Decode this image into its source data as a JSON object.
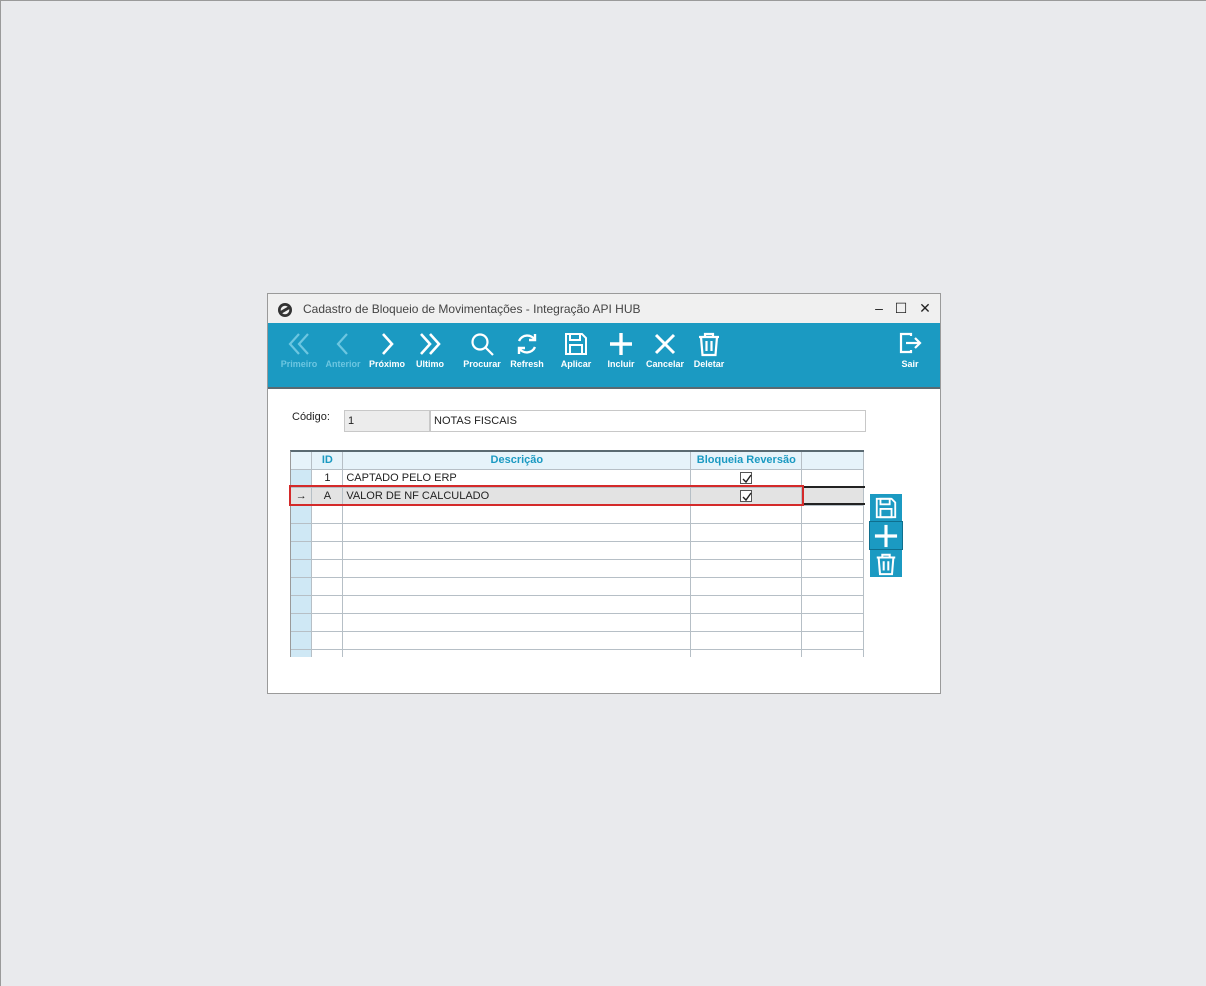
{
  "window": {
    "title": "Cadastro de Bloqueio de Movimentações - Integração API HUB",
    "controls": {
      "minimize": "–",
      "maximize": "☐",
      "close": "✕"
    }
  },
  "toolbar": {
    "buttons": [
      {
        "label": "Primeiro",
        "icon": "double-chevron-left-icon",
        "enabled": false
      },
      {
        "label": "Anterior",
        "icon": "chevron-left-icon",
        "enabled": false
      },
      {
        "label": "Próximo",
        "icon": "chevron-right-icon",
        "enabled": true
      },
      {
        "label": "Ultimo",
        "icon": "double-chevron-right-icon",
        "enabled": true
      },
      {
        "label": "Procurar",
        "icon": "search-icon",
        "enabled": true
      },
      {
        "label": "Refresh",
        "icon": "refresh-icon",
        "enabled": true
      },
      {
        "label": "Aplicar",
        "icon": "save-icon",
        "enabled": true
      },
      {
        "label": "Incluir",
        "icon": "plus-icon",
        "enabled": true
      },
      {
        "label": "Cancelar",
        "icon": "close-icon",
        "enabled": true
      },
      {
        "label": "Deletar",
        "icon": "trash-icon",
        "enabled": true
      },
      {
        "label": "Sair",
        "icon": "exit-icon",
        "enabled": true
      }
    ]
  },
  "form": {
    "codigo_label": "Código:",
    "codigo_value": "1",
    "descricao_value": "NOTAS FISCAIS"
  },
  "grid": {
    "columns": [
      "ID",
      "Descrição",
      "Bloqueia Reversão"
    ],
    "rows": [
      {
        "indicator": "",
        "id": "1",
        "descricao": "CAPTADO PELO ERP",
        "bloqueia": true
      },
      {
        "indicator": "→",
        "id": "A",
        "descricao": "VALOR DE NF CALCULADO",
        "bloqueia": true
      }
    ]
  },
  "side_buttons": [
    "save-icon",
    "plus-icon",
    "trash-icon"
  ],
  "colors": {
    "accent": "#1b9ac2",
    "selection_outline": "#d42a2a"
  }
}
